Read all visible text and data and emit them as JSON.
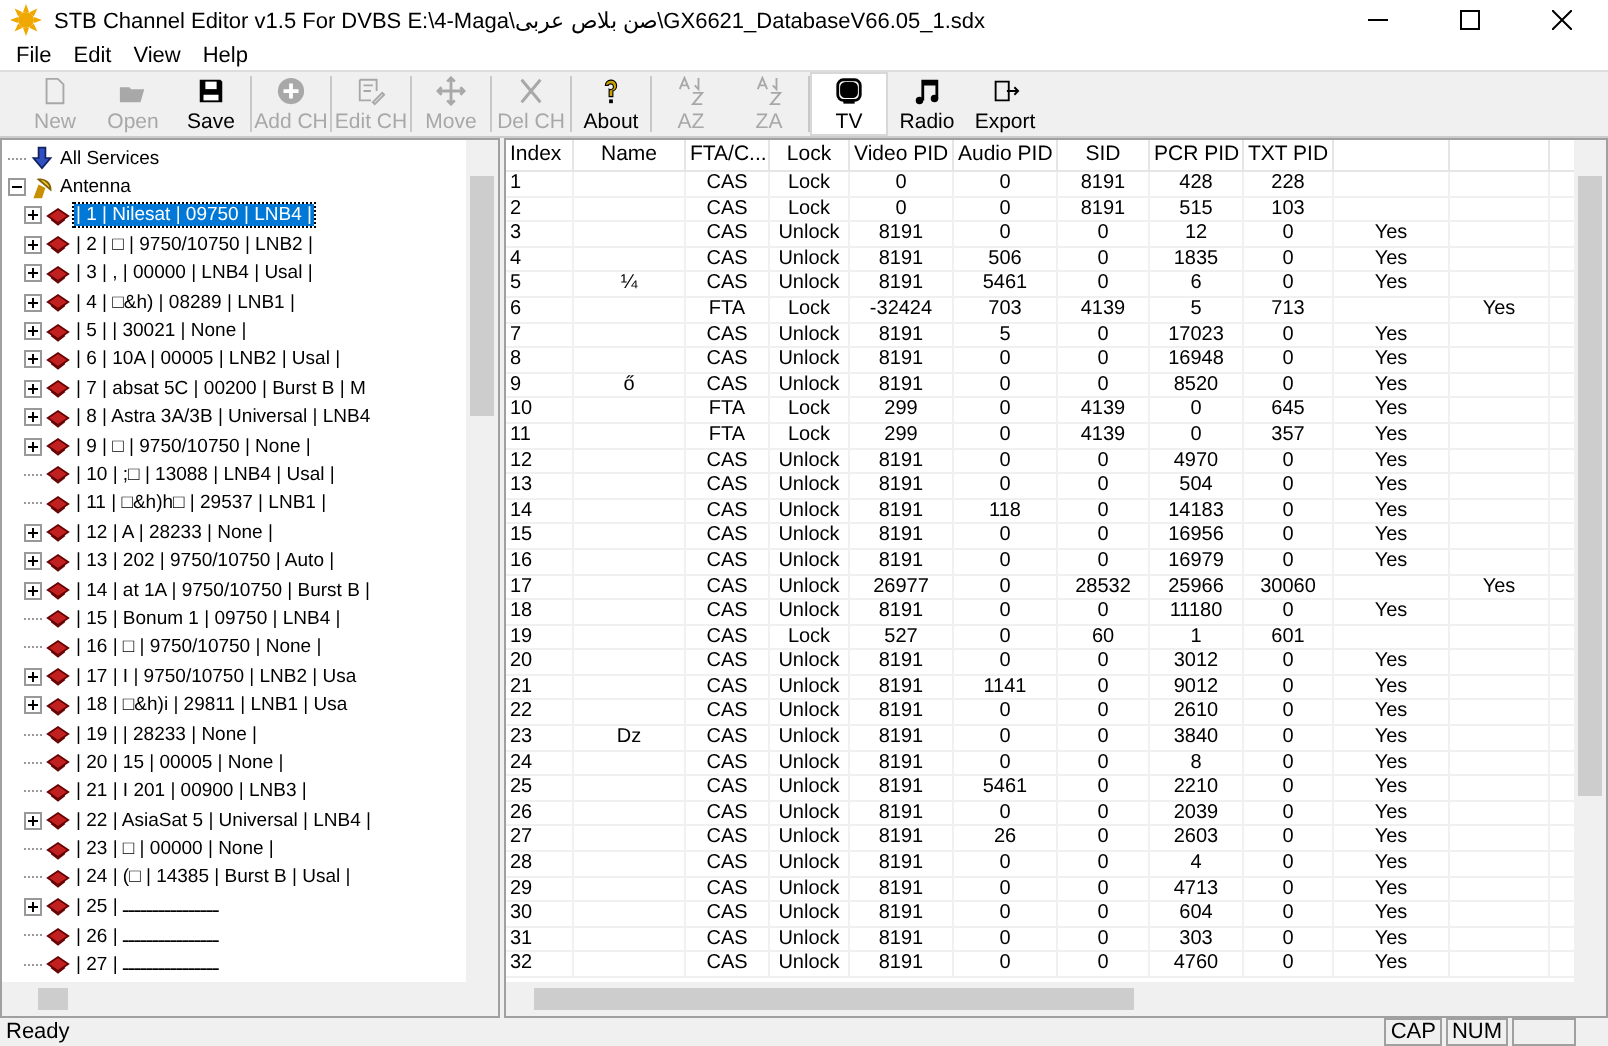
{
  "window": {
    "title": "STB Channel Editor v1.5 For DVBS  E:\\4-Maga\\صن بلاص عربى\\GX6621_DatabaseV66.05_1.sdx"
  },
  "menu": [
    "File",
    "Edit",
    "View",
    "Help"
  ],
  "toolbar": [
    {
      "kind": "new",
      "label": "New",
      "disabled": true,
      "selected": false
    },
    {
      "kind": "open",
      "label": "Open",
      "disabled": true,
      "selected": false
    },
    {
      "kind": "save",
      "label": "Save",
      "disabled": false,
      "selected": false
    },
    {
      "kind": "add",
      "label": "Add CH",
      "disabled": true,
      "selected": false
    },
    {
      "kind": "edit",
      "label": "Edit CH",
      "disabled": true,
      "selected": false
    },
    {
      "kind": "move",
      "label": "Move",
      "disabled": true,
      "selected": false
    },
    {
      "kind": "delete",
      "label": "Del CH",
      "disabled": true,
      "selected": false
    },
    {
      "kind": "about",
      "label": "About",
      "disabled": false,
      "selected": false
    },
    {
      "kind": "az",
      "label": "AZ",
      "disabled": true,
      "selected": false
    },
    {
      "kind": "za",
      "label": "ZA",
      "disabled": true,
      "selected": false
    },
    {
      "kind": "tv",
      "label": "TV",
      "disabled": false,
      "selected": true
    },
    {
      "kind": "radio",
      "label": "Radio",
      "disabled": false,
      "selected": false
    },
    {
      "kind": "export",
      "label": "Export",
      "disabled": false,
      "selected": false
    }
  ],
  "tree": {
    "items": [
      {
        "kind": "all",
        "label": "All Services",
        "selected": false
      },
      {
        "kind": "antenna",
        "label": "Antenna",
        "expanded": true,
        "selected": false,
        "children": [
          {
            "label": "| 1 | Nilesat | 09750 | LNB4 |",
            "expander": true,
            "selected": true
          },
          {
            "label": "| 2 | □ | 9750/10750 | LNB2 |",
            "expander": true,
            "selected": false
          },
          {
            "label": "| 3 | , | 00000 | LNB4 | Usal |",
            "expander": true,
            "selected": false
          },
          {
            "label": "| 4 | □&h) | 08289 | LNB1 |",
            "expander": true,
            "selected": false
          },
          {
            "label": "| 5 |  | 30021 | None |",
            "expander": true,
            "selected": false
          },
          {
            "label": "| 6 |  10A | 00005 | LNB2 | Usal |",
            "expander": true,
            "selected": false
          },
          {
            "label": "| 7 | absat 5C  | 00200 | Burst B | M",
            "expander": true,
            "selected": false
          },
          {
            "label": "| 8 | Astra 3A/3B | Universal | LNB4",
            "expander": true,
            "selected": false
          },
          {
            "label": "| 9 | □ | 9750/10750 | None |",
            "expander": true,
            "selected": false
          },
          {
            "label": "| 10 | ;□   | 13088 | LNB4 | Usal |",
            "expander": false,
            "selected": false
          },
          {
            "label": "| 11 | □&h)h□   | 29537 | LNB1 |",
            "expander": false,
            "selected": false
          },
          {
            "label": "| 12 | A | 28233 | None |",
            "expander": true,
            "selected": false
          },
          {
            "label": "| 13 | 202  | 9750/10750 | Auto |",
            "expander": true,
            "selected": false
          },
          {
            "label": "| 14 | at 1A  | 9750/10750 | Burst B |",
            "expander": true,
            "selected": false
          },
          {
            "label": "| 15 | Bonum 1 | 09750 | LNB4 |",
            "expander": false,
            "selected": false
          },
          {
            "label": "| 16 | □ | 9750/10750 | None |",
            "expander": false,
            "selected": false
          },
          {
            "label": "| 17 | I     | 9750/10750 | LNB2 | Usa",
            "expander": true,
            "selected": false
          },
          {
            "label": "| 18 | □&h)i     | 29811 | LNB1 | Usa",
            "expander": true,
            "selected": false
          },
          {
            "label": "| 19 |  | 28233 | None |",
            "expander": false,
            "selected": false
          },
          {
            "label": "| 20 |  15  | 00005 | None |",
            "expander": false,
            "selected": false
          },
          {
            "label": "| 21 | I 201  | 00900 | LNB3 |",
            "expander": false,
            "selected": false
          },
          {
            "label": "| 22 | AsiaSat 5  | Universal | LNB4 |",
            "expander": true,
            "selected": false
          },
          {
            "label": "| 23 | □ | 00000 | None |",
            "expander": false,
            "selected": false
          },
          {
            "label": "| 24 | (□   | 14385 | Burst B | Usal |",
            "expander": false,
            "selected": false
          },
          {
            "label": "| 25 | ــــــــــــــــ",
            "expander": true,
            "selected": false
          },
          {
            "label": "| 26 | ــــــــــــــــ",
            "expander": false,
            "selected": false
          },
          {
            "label": "| 27 | ــــــــــــــــ",
            "expander": false,
            "selected": false
          }
        ]
      }
    ]
  },
  "table": {
    "columns": [
      "Index",
      "Name",
      "FTA/C...",
      "Lock",
      "Video PID",
      "Audio PID",
      "SID",
      "PCR PID",
      "TXT PID"
    ],
    "rows": [
      [
        "1",
        "",
        "CAS",
        "Lock",
        "0",
        "0",
        "8191",
        "428",
        "228",
        "",
        ""
      ],
      [
        "2",
        "",
        "CAS",
        "Lock",
        "0",
        "0",
        "8191",
        "515",
        "103",
        "",
        ""
      ],
      [
        "3",
        "",
        "CAS",
        "Unlock",
        "8191",
        "0",
        "0",
        "12",
        "0",
        "Yes",
        ""
      ],
      [
        "4",
        "",
        "CAS",
        "Unlock",
        "8191",
        "506",
        "0",
        "1835",
        "0",
        "Yes",
        ""
      ],
      [
        "5",
        "¼",
        "CAS",
        "Unlock",
        "8191",
        "5461",
        "0",
        "6",
        "0",
        "Yes",
        ""
      ],
      [
        "6",
        "",
        "FTA",
        "Lock",
        "-32424",
        "703",
        "4139",
        "5",
        "713",
        "",
        "Yes"
      ],
      [
        "7",
        "",
        "CAS",
        "Unlock",
        "8191",
        "5",
        "0",
        "17023",
        "0",
        "Yes",
        ""
      ],
      [
        "8",
        "",
        "CAS",
        "Unlock",
        "8191",
        "0",
        "0",
        "16948",
        "0",
        "Yes",
        ""
      ],
      [
        "9",
        "ő",
        "CAS",
        "Unlock",
        "8191",
        "0",
        "0",
        "8520",
        "0",
        "Yes",
        ""
      ],
      [
        "10",
        "",
        "FTA",
        "Lock",
        "299",
        "0",
        "4139",
        "0",
        "645",
        "Yes",
        ""
      ],
      [
        "11",
        "",
        "FTA",
        "Lock",
        "299",
        "0",
        "4139",
        "0",
        "357",
        "Yes",
        ""
      ],
      [
        "12",
        "",
        "CAS",
        "Unlock",
        "8191",
        "0",
        "0",
        "4970",
        "0",
        "Yes",
        ""
      ],
      [
        "13",
        "",
        "CAS",
        "Unlock",
        "8191",
        "0",
        "0",
        "504",
        "0",
        "Yes",
        ""
      ],
      [
        "14",
        "",
        "CAS",
        "Unlock",
        "8191",
        "118",
        "0",
        "14183",
        "0",
        "Yes",
        ""
      ],
      [
        "15",
        "",
        "CAS",
        "Unlock",
        "8191",
        "0",
        "0",
        "16956",
        "0",
        "Yes",
        ""
      ],
      [
        "16",
        "",
        "CAS",
        "Unlock",
        "8191",
        "0",
        "0",
        "16979",
        "0",
        "Yes",
        ""
      ],
      [
        "17",
        "",
        "CAS",
        "Unlock",
        "26977",
        "0",
        "28532",
        "25966",
        "30060",
        "",
        "Yes"
      ],
      [
        "18",
        "",
        "CAS",
        "Unlock",
        "8191",
        "0",
        "0",
        "11180",
        "0",
        "Yes",
        ""
      ],
      [
        "19",
        "",
        "CAS",
        "Lock",
        "527",
        "0",
        "60",
        "1",
        "601",
        "",
        ""
      ],
      [
        "20",
        "",
        "CAS",
        "Unlock",
        "8191",
        "0",
        "0",
        "3012",
        "0",
        "Yes",
        ""
      ],
      [
        "21",
        "",
        "CAS",
        "Unlock",
        "8191",
        "1141",
        "0",
        "9012",
        "0",
        "Yes",
        ""
      ],
      [
        "22",
        "",
        "CAS",
        "Unlock",
        "8191",
        "0",
        "0",
        "2610",
        "0",
        "Yes",
        ""
      ],
      [
        "23",
        "Dz",
        "CAS",
        "Unlock",
        "8191",
        "0",
        "0",
        "3840",
        "0",
        "Yes",
        ""
      ],
      [
        "24",
        "",
        "CAS",
        "Unlock",
        "8191",
        "0",
        "0",
        "8",
        "0",
        "Yes",
        ""
      ],
      [
        "25",
        "",
        "CAS",
        "Unlock",
        "8191",
        "5461",
        "0",
        "2210",
        "0",
        "Yes",
        ""
      ],
      [
        "26",
        "",
        "CAS",
        "Unlock",
        "8191",
        "0",
        "0",
        "2039",
        "0",
        "Yes",
        ""
      ],
      [
        "27",
        "",
        "CAS",
        "Unlock",
        "8191",
        "26",
        "0",
        "2603",
        "0",
        "Yes",
        ""
      ],
      [
        "28",
        "",
        "CAS",
        "Unlock",
        "8191",
        "0",
        "0",
        "4",
        "0",
        "Yes",
        ""
      ],
      [
        "29",
        "",
        "CAS",
        "Unlock",
        "8191",
        "0",
        "0",
        "4713",
        "0",
        "Yes",
        ""
      ],
      [
        "30",
        "",
        "CAS",
        "Unlock",
        "8191",
        "0",
        "0",
        "604",
        "0",
        "Yes",
        ""
      ],
      [
        "31",
        "",
        "CAS",
        "Unlock",
        "8191",
        "0",
        "0",
        "303",
        "0",
        "Yes",
        ""
      ],
      [
        "32",
        "",
        "CAS",
        "Unlock",
        "8191",
        "0",
        "0",
        "4760",
        "0",
        "Yes",
        ""
      ]
    ]
  },
  "status_bar": {
    "text": "Ready",
    "indicators": [
      "CAP",
      "NUM"
    ]
  }
}
